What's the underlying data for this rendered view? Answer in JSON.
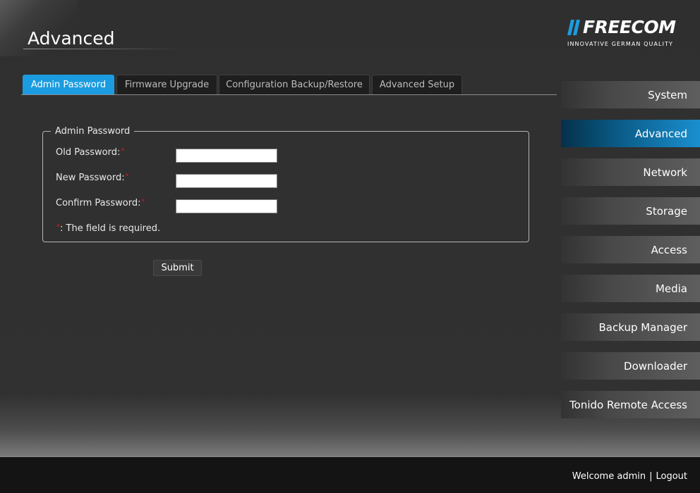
{
  "page": {
    "title": "Advanced"
  },
  "brand": {
    "name": "FREECOM",
    "tagline": "INNOVATIVE GERMAN QUALITY",
    "accent_color": "#1c9ce0"
  },
  "tabs": [
    {
      "label": "Admin Password",
      "active": true
    },
    {
      "label": "Firmware Upgrade",
      "active": false
    },
    {
      "label": "Configuration Backup/Restore",
      "active": false
    },
    {
      "label": "Advanced Setup",
      "active": false
    }
  ],
  "form": {
    "legend": "Admin Password",
    "fields": [
      {
        "label": "Old Password:",
        "value": ""
      },
      {
        "label": "New Password:",
        "value": ""
      },
      {
        "label": "Confirm Password:",
        "value": ""
      }
    ],
    "required_marker": "*",
    "required_note": ": The field is required.",
    "submit_label": "Submit"
  },
  "nav": {
    "items": [
      {
        "label": "System",
        "active": false
      },
      {
        "label": "Advanced",
        "active": true
      },
      {
        "label": "Network",
        "active": false
      },
      {
        "label": "Storage",
        "active": false
      },
      {
        "label": "Access",
        "active": false
      },
      {
        "label": "Media",
        "active": false
      },
      {
        "label": "Backup Manager",
        "active": false
      },
      {
        "label": "Downloader",
        "active": false
      },
      {
        "label": "Tonido Remote Access",
        "active": false
      }
    ]
  },
  "footer": {
    "welcome": "Welcome admin",
    "separator": "|",
    "logout": "Logout"
  }
}
